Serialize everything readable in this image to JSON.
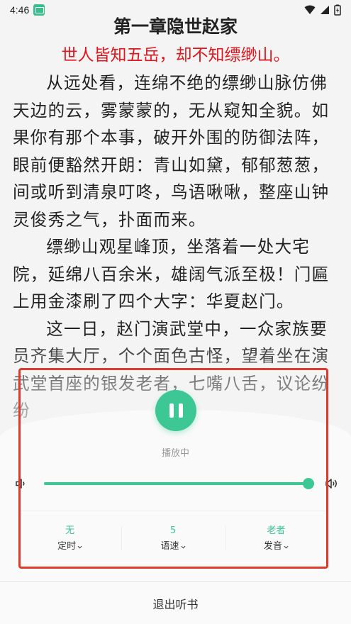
{
  "status_bar": {
    "time": "4:46"
  },
  "reader": {
    "chapter_title": "第一章隐世赵家",
    "chapter_subtitle": "世人皆知五岳，却不知缥缈山。",
    "paragraphs": [
      "从远处看，连绵不绝的缥缈山脉仿佛天边的云，雾蒙蒙的，无从窥知全貌。如果你有那个本事，破开外围的防御法阵，眼前便豁然开朗：青山如黛，郁郁葱葱，间或听到清泉叮咚，鸟语啾啾，整座山钟灵俊秀之气，扑面而来。",
      "缥缈山观星峰顶，坐落着一处大宅院，延绵八百余米，雄阔气派至极！门匾上用金漆刷了四个大字：华夏赵门。",
      "这一日，赵门演武堂中，一众家族要员齐集大厅，个个面色古怪，望着坐在演武堂首座的银发老者，七嘴八舌，议论纷纷"
    ]
  },
  "player": {
    "status": "播放中",
    "volume_level": 1.0,
    "options": [
      {
        "value": "无",
        "label": "定时"
      },
      {
        "value": "5",
        "label": "语速"
      },
      {
        "value": "老者",
        "label": "发音"
      }
    ],
    "exit_label": "退出听书"
  },
  "colors": {
    "accent": "#3cc795",
    "highlight_red": "#dc3b30",
    "subtitle_red": "#e0161d"
  }
}
